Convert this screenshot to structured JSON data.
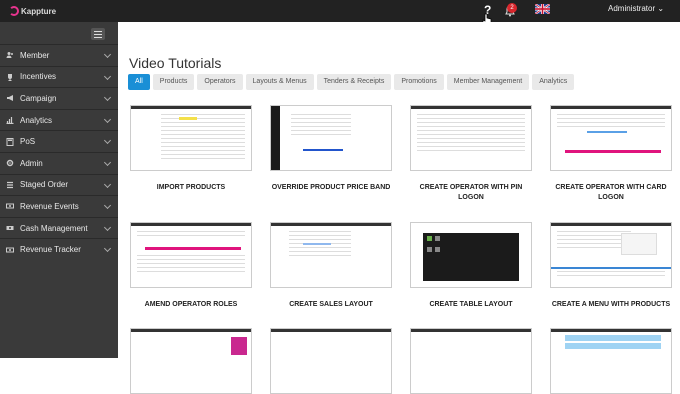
{
  "app": {
    "logo_text": "Kappture",
    "help_label": "?",
    "notification_count": "2",
    "user_label": "Administrator"
  },
  "sidebar": {
    "items": [
      {
        "label": "Member"
      },
      {
        "label": "Incentives"
      },
      {
        "label": "Campaign"
      },
      {
        "label": "Analytics"
      },
      {
        "label": "PoS"
      },
      {
        "label": "Admin"
      },
      {
        "label": "Staged Order"
      },
      {
        "label": "Revenue Events"
      },
      {
        "label": "Cash Management"
      },
      {
        "label": "Revenue Tracker"
      }
    ]
  },
  "main": {
    "title": "Video Tutorials",
    "tabs": [
      {
        "label": "All"
      },
      {
        "label": "Products"
      },
      {
        "label": "Operators"
      },
      {
        "label": "Layouts & Menus"
      },
      {
        "label": "Tenders & Receipts"
      },
      {
        "label": "Promotions"
      },
      {
        "label": "Member Management"
      },
      {
        "label": "Analytics"
      }
    ],
    "videos": [
      {
        "title": "IMPORT PRODUCTS"
      },
      {
        "title": "OVERRIDE PRODUCT PRICE BAND"
      },
      {
        "title": "CREATE OPERATOR WITH PIN LOGON"
      },
      {
        "title": "CREATE OPERATOR WITH CARD LOGON"
      },
      {
        "title": "AMEND OPERATOR ROLES"
      },
      {
        "title": "CREATE SALES LAYOUT"
      },
      {
        "title": "CREATE TABLE LAYOUT"
      },
      {
        "title": "CREATE A MENU WITH PRODUCTS"
      }
    ]
  },
  "colors": {
    "accent": "#1a8fd6",
    "brand": "#e0147d",
    "sidebar": "#3a3a3a",
    "topbar": "#222222"
  }
}
